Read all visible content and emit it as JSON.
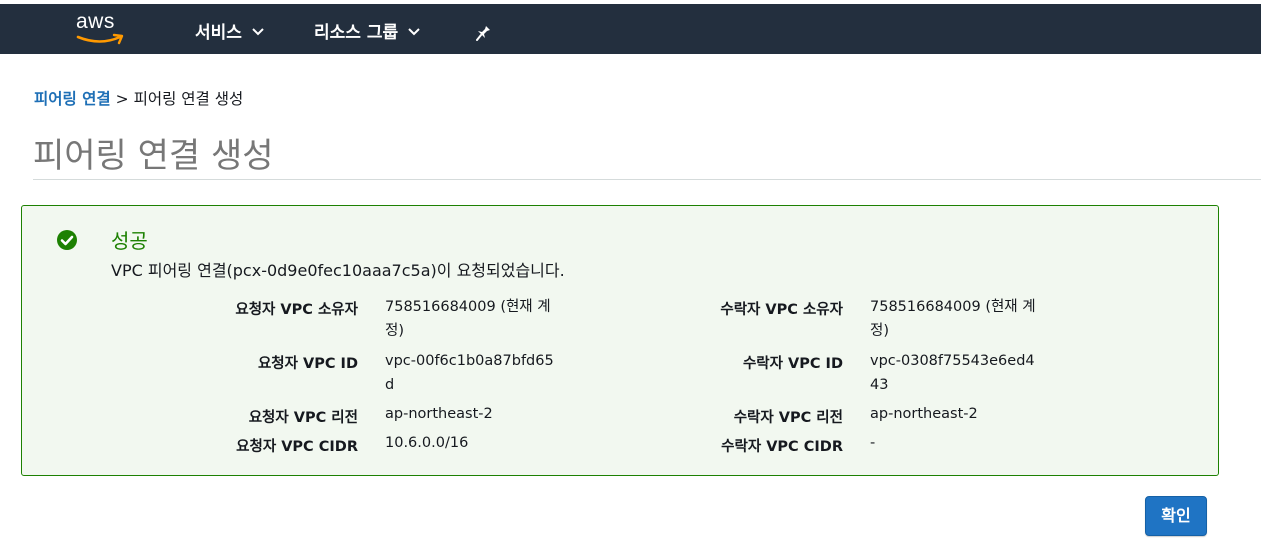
{
  "topbar": {
    "logo_text": "aws",
    "nav": [
      {
        "label": "서비스"
      },
      {
        "label": "리소스 그룹"
      }
    ],
    "bg_color": "#232f3e"
  },
  "breadcrumb": {
    "link": "피어링 연결",
    "separator": ">",
    "current": "피어링 연결 생성"
  },
  "page_title": "피어링 연결 생성",
  "alert": {
    "title": "성공",
    "message": "VPC 피어링 연결(pcx-0d9e0fec10aaa7c5a)이 요청되었습니다.",
    "color": "#1d8102",
    "requester": [
      {
        "label": "요청자 VPC 소유자",
        "value": "758516684009 (현재 계정)"
      },
      {
        "label": "요청자 VPC ID",
        "value": "vpc-00f6c1b0a87bfd65d"
      },
      {
        "label": "요청자 VPC 리전",
        "value": "ap-northeast-2"
      },
      {
        "label": "요청자 VPC CIDR",
        "value": "10.6.0.0/16"
      }
    ],
    "accepter": [
      {
        "label": "수락자 VPC 소유자",
        "value": "758516684009 (현재 계정)"
      },
      {
        "label": "수락자 VPC ID",
        "value": "vpc-0308f75543e6ed443"
      },
      {
        "label": "수락자 VPC 리전",
        "value": "ap-northeast-2"
      },
      {
        "label": "수락자 VPC CIDR",
        "value": "-"
      }
    ]
  },
  "confirm_label": "확인",
  "icons": {
    "logo": "aws-logo",
    "chevron": "chevron-down-icon",
    "pin": "pin-icon",
    "success": "check-circle-icon"
  }
}
